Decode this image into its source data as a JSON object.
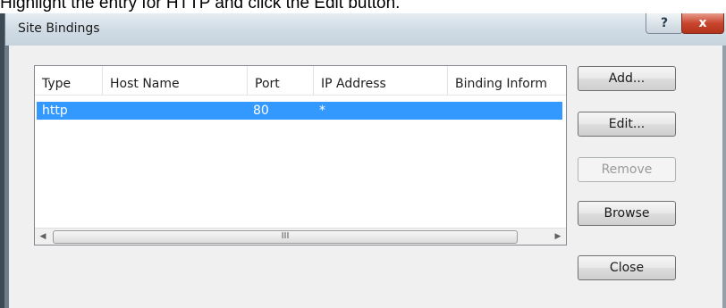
{
  "instruction": "Highlight the entry for HTTP and click the Edit button.",
  "window": {
    "title": "Site Bindings",
    "help_glyph": "?",
    "close_glyph": "x"
  },
  "table": {
    "columns": [
      "Type",
      "Host Name",
      "Port",
      "IP Address",
      "Binding Inform"
    ],
    "rows": [
      {
        "type": "http",
        "host_name": "",
        "port": "80",
        "ip_address": "*",
        "binding_info": ""
      }
    ],
    "selected_row": 0
  },
  "scrollbar": {
    "left_arrow": "◀",
    "right_arrow": "▶",
    "thumb_grip": "III"
  },
  "buttons": {
    "add": "Add...",
    "edit": "Edit...",
    "remove": "Remove",
    "browse": "Browse",
    "close": "Close"
  },
  "colors": {
    "selection": "#3399ff",
    "close_button": "#c9452e"
  }
}
